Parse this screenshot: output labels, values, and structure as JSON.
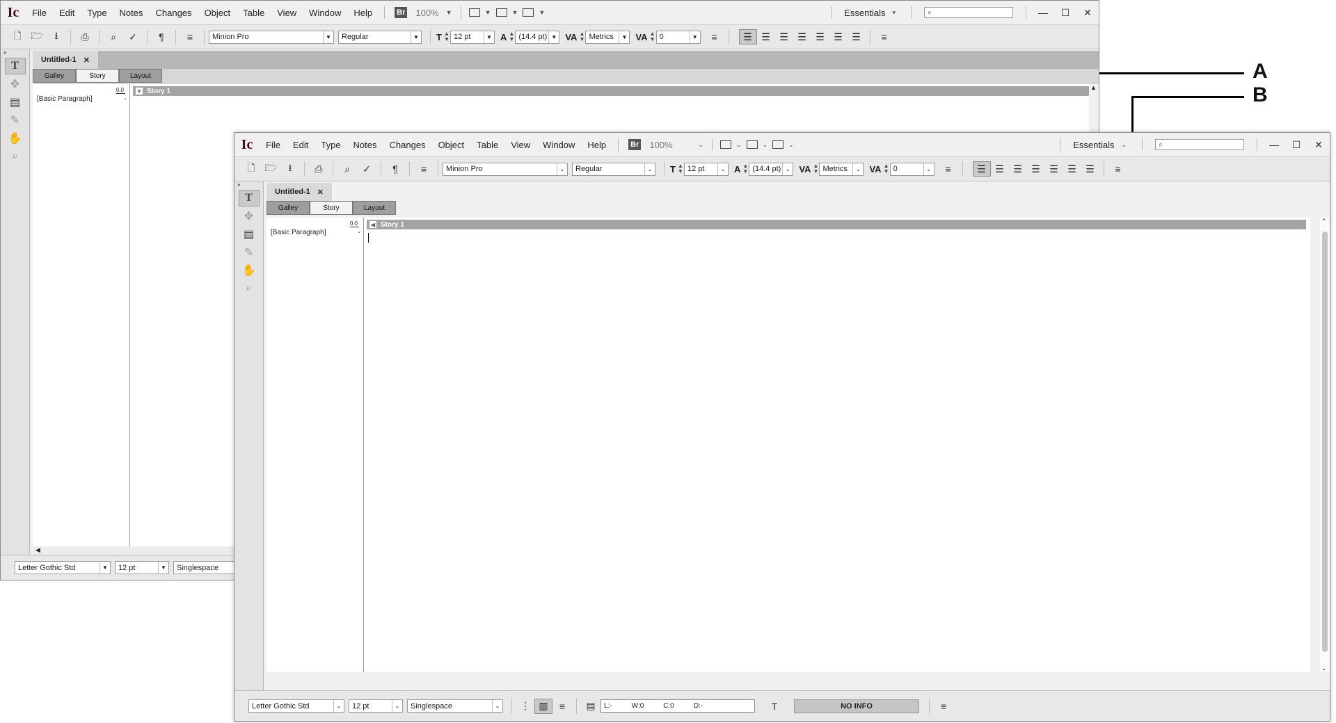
{
  "menu": {
    "logo": "Ic",
    "items": [
      "File",
      "Edit",
      "Type",
      "Notes",
      "Changes",
      "Object",
      "Table",
      "View",
      "Window",
      "Help"
    ],
    "bridge": "Br",
    "zoom": "100%",
    "workspace": "Essentials"
  },
  "toolbar": {
    "font_family": "Minion Pro",
    "font_style": "Regular",
    "font_size": "12 pt",
    "leading": "(14.4 pt)",
    "kerning": "Metrics",
    "tracking": "0"
  },
  "document": {
    "tab_title": "Untitled-1",
    "modes": [
      "Galley",
      "Story",
      "Layout"
    ],
    "active_mode": "Story",
    "depth_label": "0.0",
    "paragraph_style": "[Basic Paragraph]",
    "style_dash": "-",
    "story_title": "Story 1"
  },
  "status": {
    "font": "Letter Gothic Std",
    "size": "12 pt",
    "spacing": "Singlespace",
    "line": "L:-",
    "words": "W:0",
    "chars": "C:0",
    "depth": "D:-",
    "no_info": "NO INFO"
  },
  "callouts": {
    "a": "A",
    "b": "B"
  }
}
